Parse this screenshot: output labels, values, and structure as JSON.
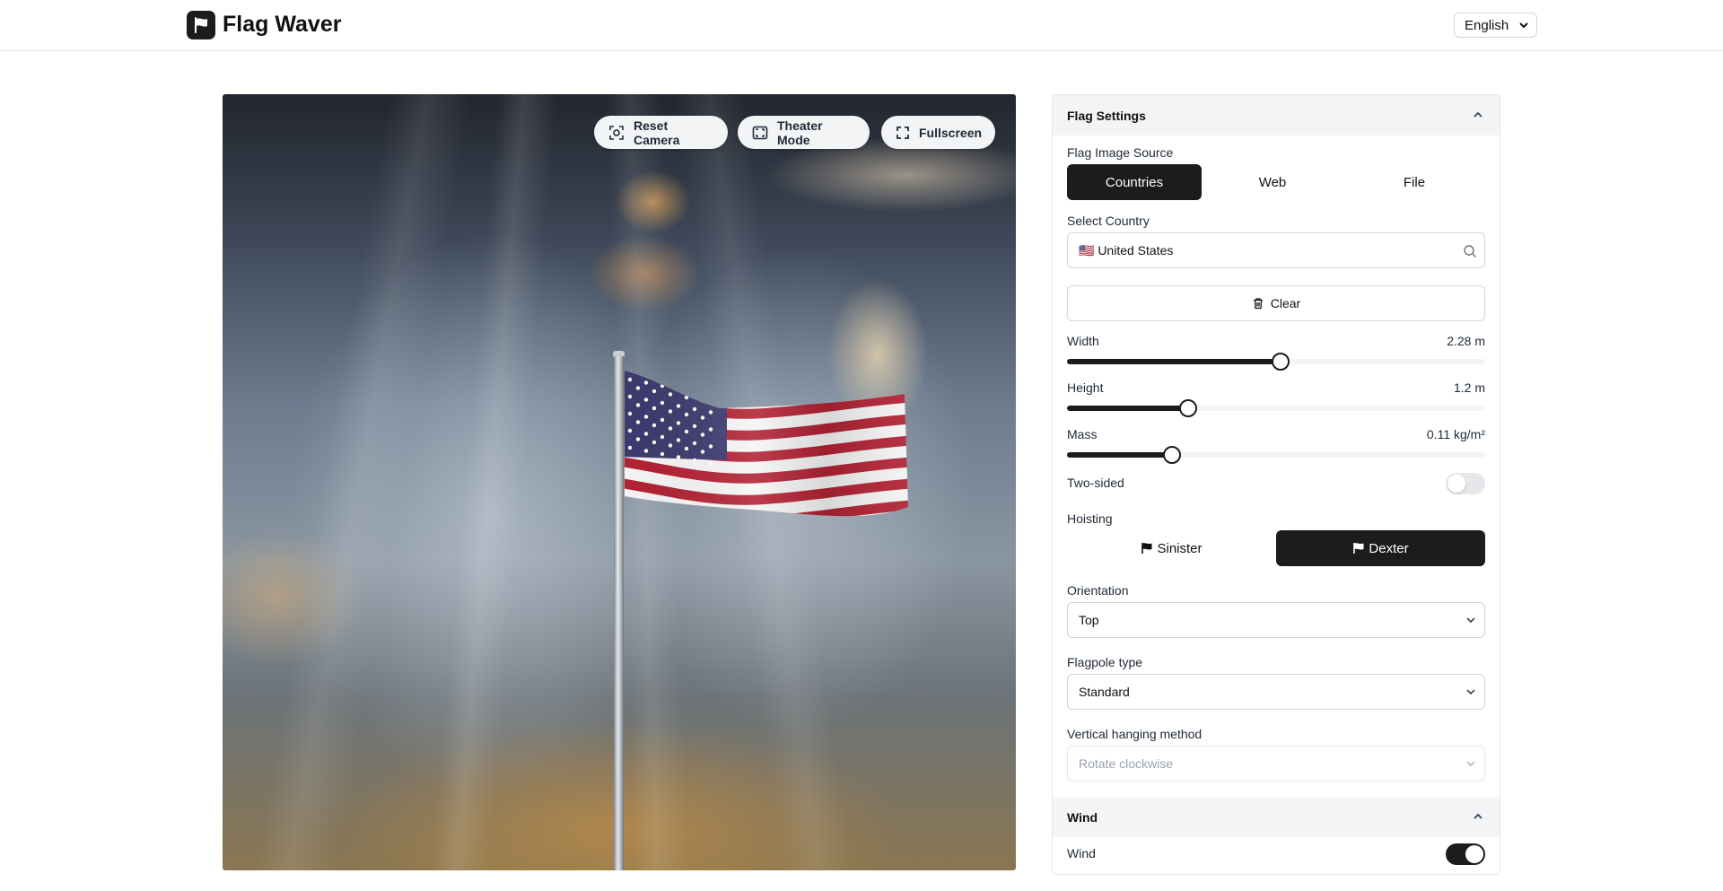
{
  "header": {
    "app_title": "Flag Waver",
    "language": "English"
  },
  "viewport": {
    "buttons": {
      "reset_camera": "Reset Camera",
      "theater_mode": "Theater Mode",
      "fullscreen": "Fullscreen"
    }
  },
  "settings": {
    "title": "Flag Settings",
    "image_source": {
      "label": "Flag Image Source",
      "options": [
        "Countries",
        "Web",
        "File"
      ],
      "selected": "Countries"
    },
    "country": {
      "label": "Select Country",
      "value": "🇺🇸 United States"
    },
    "clear_label": "Clear",
    "width": {
      "label": "Width",
      "display": "2.28 m",
      "fraction": 0.51
    },
    "height": {
      "label": "Height",
      "display": "1.2 m",
      "fraction": 0.29
    },
    "mass": {
      "label": "Mass",
      "display": "0.11 kg/m²",
      "fraction": 0.25
    },
    "two_sided": {
      "label": "Two-sided",
      "on": false
    },
    "hoisting": {
      "label": "Hoisting",
      "options": [
        "Sinister",
        "Dexter"
      ],
      "selected": "Dexter"
    },
    "orientation": {
      "label": "Orientation",
      "value": "Top"
    },
    "flagpole_type": {
      "label": "Flagpole type",
      "value": "Standard"
    },
    "vertical_hanging": {
      "label": "Vertical hanging method",
      "value": "Rotate clockwise"
    }
  },
  "wind": {
    "title": "Wind",
    "toggle": {
      "label": "Wind",
      "on": true
    }
  },
  "colors": {
    "dark": "#1c1c1c",
    "flag_red": "#b22234",
    "flag_blue": "#3c3b6e"
  }
}
